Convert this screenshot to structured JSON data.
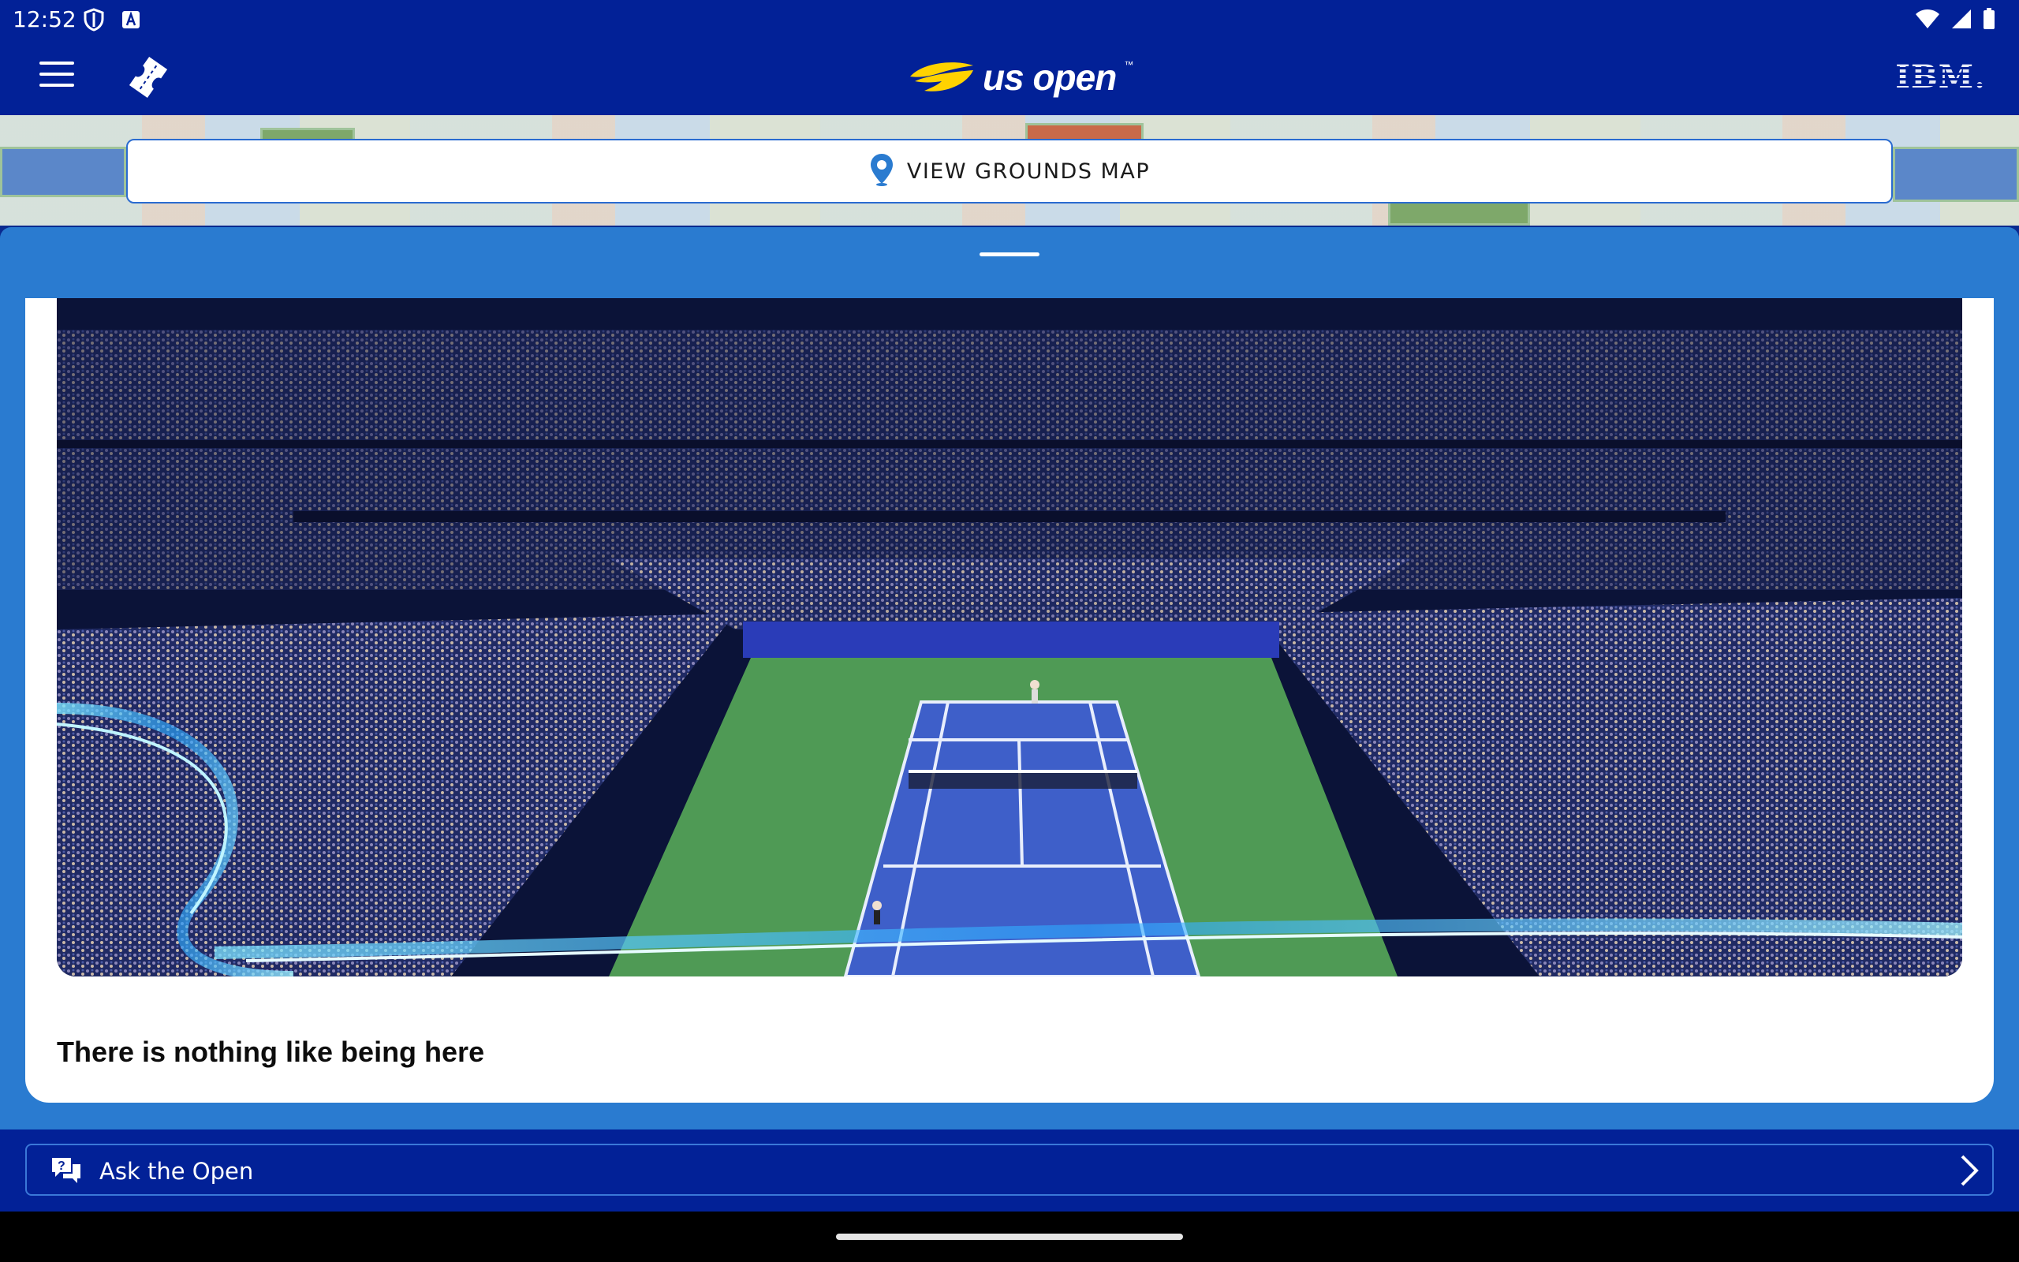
{
  "status_bar": {
    "time": "12:52",
    "left_icons": [
      "shield-icon",
      "a-icon"
    ],
    "right_icons": [
      "wifi-icon",
      "cell-signal-icon",
      "battery-icon"
    ]
  },
  "app_bar": {
    "menu_icon": "hamburger-menu-icon",
    "ticket_icon": "ticket-icon",
    "logo_text": "us open",
    "logo_tm": "™",
    "ibm_text": "IBM."
  },
  "map": {
    "button_label": "VIEW GROUNDS MAP",
    "icon": "map-pin-icon"
  },
  "card": {
    "image_alt": "Arthur Ashe Stadium at night",
    "title": "There is nothing like being here"
  },
  "ask": {
    "label": "Ask the Open",
    "icon": "chat-question-icon",
    "chevron": "chevron-right-icon"
  },
  "colors": {
    "brand_navy": "#022197",
    "sheet_blue": "#2a7bd0",
    "court_green": "#4f9a55",
    "court_blue": "#3e5fc9",
    "accent_yellow": "#ffd200"
  }
}
